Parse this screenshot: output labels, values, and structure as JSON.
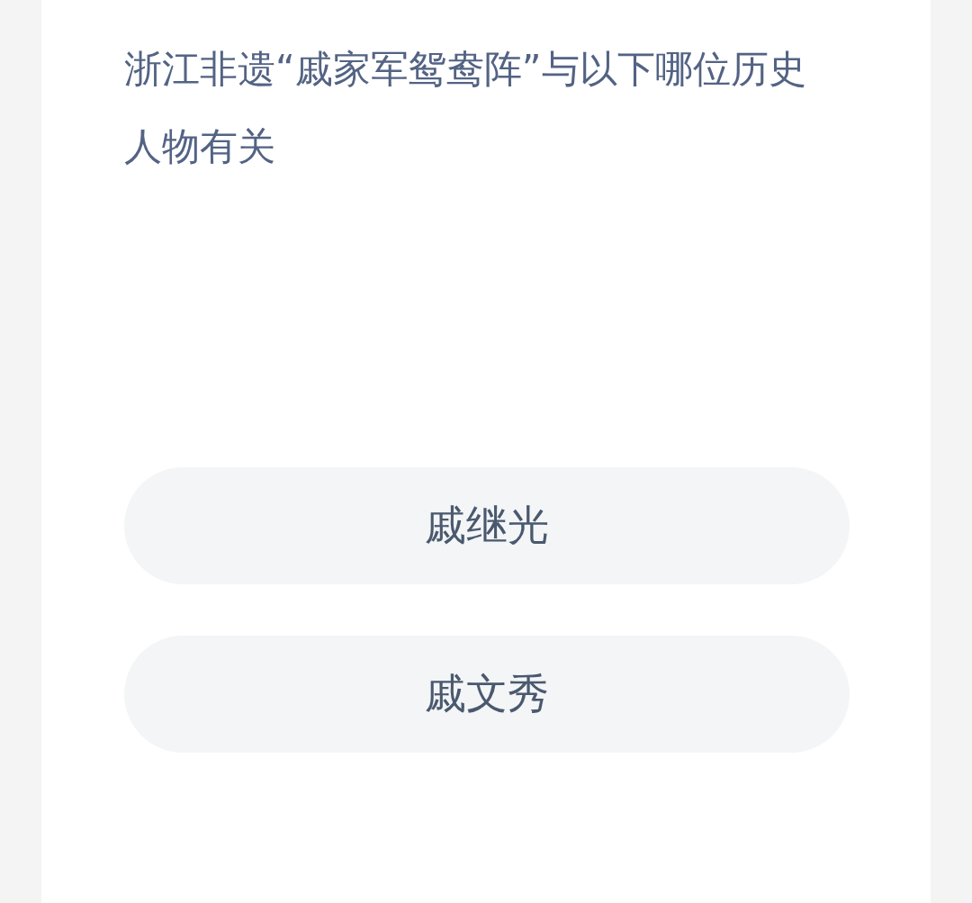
{
  "question": "浙江非遗“戚家军鸳鸯阵”与以下哪位历史人物有关",
  "options": [
    {
      "label": "戚继光"
    },
    {
      "label": "戚文秀"
    }
  ]
}
